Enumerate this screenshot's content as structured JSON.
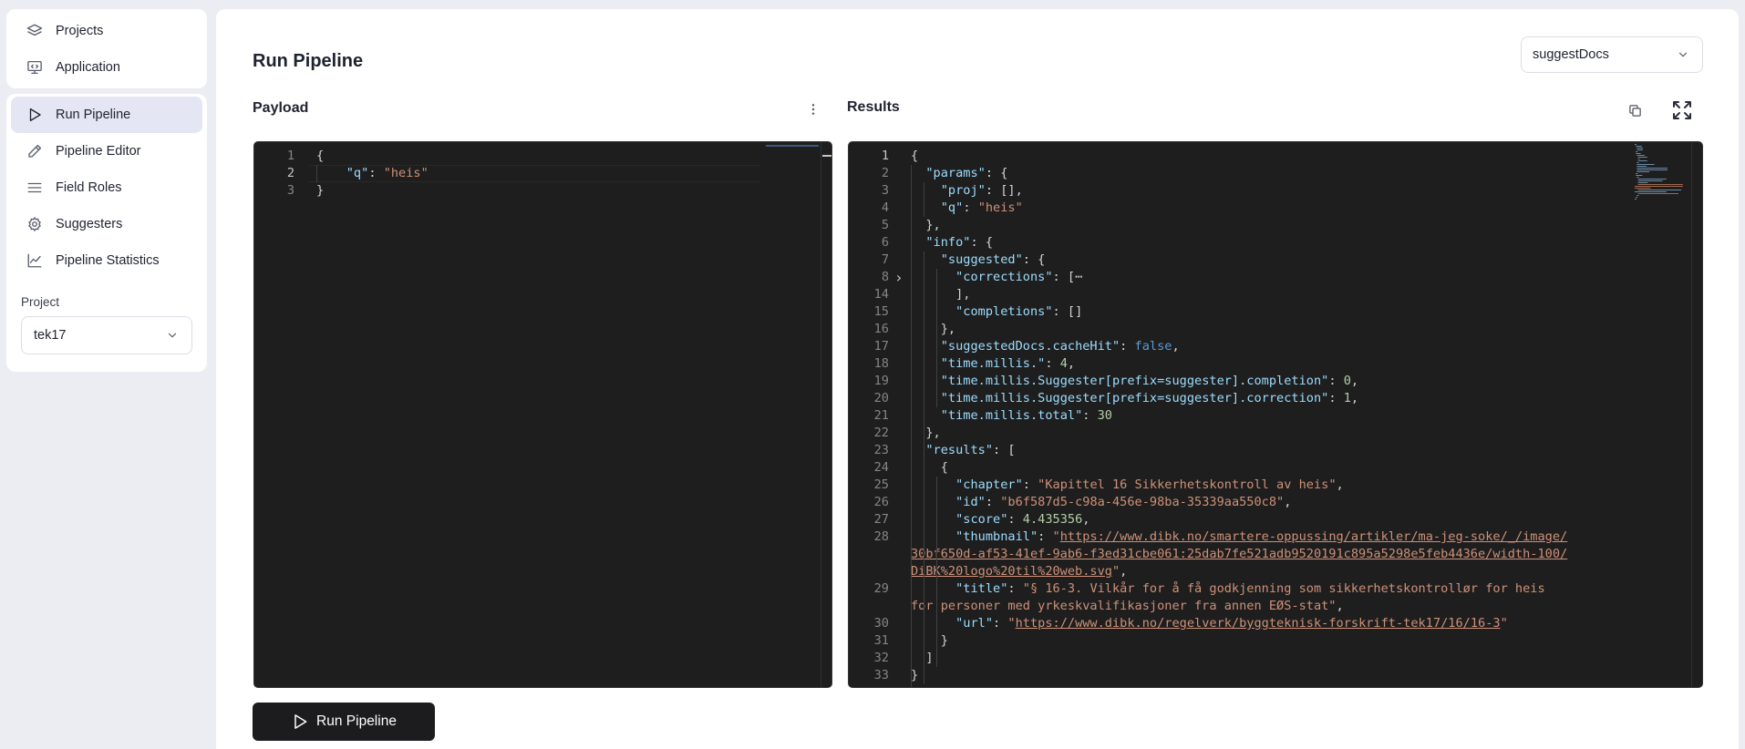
{
  "nav": {
    "top_items": [
      {
        "label": "Projects",
        "icon": "layers-icon"
      },
      {
        "label": "Application",
        "icon": "monitor-code-icon"
      }
    ],
    "items": [
      {
        "label": "Run Pipeline",
        "icon": "play-icon"
      },
      {
        "label": "Pipeline Editor",
        "icon": "pencil-icon"
      },
      {
        "label": "Field Roles",
        "icon": "list-icon"
      },
      {
        "label": "Suggesters",
        "icon": "gear-icon"
      },
      {
        "label": "Pipeline Statistics",
        "icon": "chart-line-icon"
      }
    ],
    "project_label": "Project",
    "project_value": "tek17"
  },
  "main": {
    "title": "Run Pipeline",
    "pipeline_select": "suggestDocs",
    "payload_title": "Payload",
    "results_title": "Results",
    "run_button": "Run Pipeline"
  },
  "payload": {
    "lines": [
      {
        "n": "1",
        "t": "{"
      },
      {
        "n": "2",
        "t": "    \"q\": \"heis\""
      },
      {
        "n": "3",
        "t": "}"
      }
    ]
  },
  "results": {
    "lines": [
      {
        "n": "1",
        "t": "{"
      },
      {
        "n": "2",
        "t": "  \"params\": {"
      },
      {
        "n": "3",
        "t": "    \"proj\": [],"
      },
      {
        "n": "4",
        "t": "    \"q\": \"heis\""
      },
      {
        "n": "5",
        "t": "  },"
      },
      {
        "n": "6",
        "t": "  \"info\": {"
      },
      {
        "n": "7",
        "t": "    \"suggested\": {"
      },
      {
        "n": "8",
        "t": "      \"corrections\": [⋯"
      },
      {
        "n": "14",
        "t": "      ],"
      },
      {
        "n": "15",
        "t": "      \"completions\": []"
      },
      {
        "n": "16",
        "t": "    },"
      },
      {
        "n": "17",
        "t": "    \"suggestedDocs.cacheHit\": false,"
      },
      {
        "n": "18",
        "t": "    \"time.millis.\": 4,"
      },
      {
        "n": "19",
        "t": "    \"time.millis.Suggester[prefix=suggester].completion\": 0,"
      },
      {
        "n": "20",
        "t": "    \"time.millis.Suggester[prefix=suggester].correction\": 1,"
      },
      {
        "n": "21",
        "t": "    \"time.millis.total\": 30"
      },
      {
        "n": "22",
        "t": "  },"
      },
      {
        "n": "23",
        "t": "  \"results\": ["
      },
      {
        "n": "24",
        "t": "    {"
      },
      {
        "n": "25",
        "t": "      \"chapter\": \"Kapittel 16 Sikkerhetskontroll av heis\","
      },
      {
        "n": "26",
        "t": "      \"id\": \"b6f587d5-c98a-456e-98ba-35339aa550c8\","
      },
      {
        "n": "27",
        "t": "      \"score\": 4.435356,"
      },
      {
        "n": "28",
        "t": "      \"thumbnail\": \"https://www.dibk.no/smartere-oppussing/artikler/ma-jeg-soke/_/image/"
      },
      {
        "n": "",
        "t": "30bf650d-af53-41ef-9ab6-f3ed31cbe061:25dab7fe521adb9520191c895a5298e5feb4436e/width-100/"
      },
      {
        "n": "",
        "t": "DiBK%20logo%20til%20web.svg\","
      },
      {
        "n": "29",
        "t": "      \"title\": \"§ 16-3. Vilkår for å få godkjenning som sikkerhetskontrollør for heis"
      },
      {
        "n": "",
        "t": "for personer med yrkeskvalifikasjoner fra annen EØS-stat\","
      },
      {
        "n": "30",
        "t": "      \"url\": \"https://www.dibk.no/regelverk/byggteknisk-forskrift-tek17/16/16-3\""
      },
      {
        "n": "31",
        "t": "    }"
      },
      {
        "n": "32",
        "t": "  ]"
      },
      {
        "n": "33",
        "t": "}"
      }
    ]
  }
}
